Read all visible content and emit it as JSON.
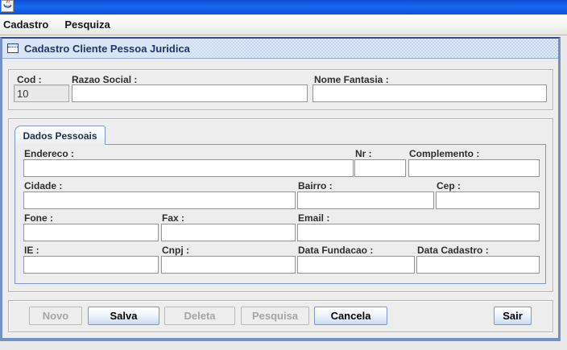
{
  "window": {
    "icon": "java-cup-icon",
    "menubar": {
      "items": [
        {
          "label": "Cadastro"
        },
        {
          "label": "Pesquiza"
        }
      ]
    }
  },
  "frame": {
    "title": "Cadastro Cliente Pessoa Juridica",
    "header_fields": {
      "cod": {
        "label": "Cod :",
        "value": "10"
      },
      "razao_social": {
        "label": "Razao Social :",
        "value": ""
      },
      "nome_fantasia": {
        "label": "Nome Fantasia :",
        "value": ""
      }
    },
    "tabs": [
      {
        "label": "Dados Pessoais",
        "selected": true
      }
    ],
    "form": {
      "endereco": {
        "label": "Endereco :",
        "value": ""
      },
      "nr": {
        "label": "Nr :",
        "value": ""
      },
      "complemento": {
        "label": "Complemento :",
        "value": ""
      },
      "cidade": {
        "label": "Cidade :",
        "value": ""
      },
      "bairro": {
        "label": "Bairro :",
        "value": ""
      },
      "cep": {
        "label": "Cep :",
        "value": ""
      },
      "fone": {
        "label": "Fone :",
        "value": ""
      },
      "fax": {
        "label": "Fax :",
        "value": ""
      },
      "email": {
        "label": "Email :",
        "value": ""
      },
      "ie": {
        "label": "IE :",
        "value": ""
      },
      "cnpj": {
        "label": "Cnpj :",
        "value": ""
      },
      "data_fundacao": {
        "label": "Data Fundacao :",
        "value": ""
      },
      "data_cadastro": {
        "label": "Data Cadastro :",
        "value": ""
      }
    },
    "buttons": [
      {
        "label": "Novo",
        "enabled": false
      },
      {
        "label": "Salva",
        "enabled": true
      },
      {
        "label": "Deleta",
        "enabled": false
      },
      {
        "label": "Pesquisa",
        "enabled": false
      },
      {
        "label": "Cancela",
        "enabled": true
      },
      {
        "label": "Sair",
        "enabled": true
      }
    ]
  },
  "colors": {
    "titlebar_blue": "#1a69f2",
    "frame_border": "#7591c4",
    "frame_title_text": "#21356b",
    "accent_button_border": "#7c97c9",
    "button_gradient_bottom": "#cadcf2",
    "panel_background": "#ededed",
    "disabled_text": "#a5a5a5"
  }
}
